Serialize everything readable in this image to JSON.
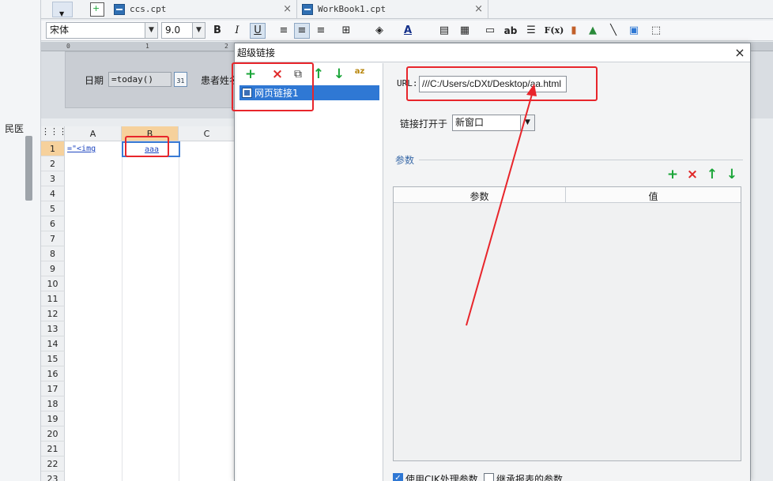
{
  "left_strip": {
    "text_1": "民医"
  },
  "tabs": [
    {
      "label": "ccs.cpt",
      "close": "×"
    },
    {
      "label": "WorkBook1.cpt",
      "close": "×"
    }
  ],
  "toolbar": {
    "font_name": "宋体",
    "font_size": "9.0",
    "bold": "B",
    "italic": "I",
    "underline": "U",
    "text_btn": "ab",
    "formula": "F(x)",
    "font_color": "A"
  },
  "param_pane": {
    "date_label": "日期",
    "date_value": "=today()",
    "cal_day": "31",
    "patient_label": "患者姓名"
  },
  "grid": {
    "columns": [
      "A",
      "B",
      "C"
    ],
    "rows": [
      "1",
      "2",
      "3",
      "4",
      "5",
      "6",
      "7",
      "8",
      "9",
      "10",
      "11",
      "12",
      "13",
      "14",
      "15",
      "16",
      "17",
      "18",
      "19",
      "20",
      "21",
      "22",
      "23"
    ],
    "cell_a1": "=\"<img",
    "cell_b1": "aaa"
  },
  "dialog": {
    "title": "超级链接",
    "close": "×",
    "link_toolbar": {
      "add": "+",
      "remove": "×",
      "copy": "⧉",
      "up": "↑",
      "down": "↓",
      "sort": "az"
    },
    "links": [
      {
        "label": "网页链接1"
      }
    ],
    "url_label": "URL:",
    "url_value": "///C:/Users/cDXt/Desktop/aa.html",
    "open_in_label": "链接打开于",
    "open_in_value": "新窗口",
    "params_legend": "参数",
    "params_toolbar": {
      "add": "+",
      "remove": "×",
      "up": "↑",
      "down": "↓"
    },
    "params_columns": [
      "参数",
      "值"
    ],
    "option_cjk": "使用CJK处理参数",
    "option_inherit": "继承报表的参数"
  },
  "colors": {
    "annotation_red": "#e8252b",
    "selection_blue": "#2f78d4",
    "add_green": "#1aa538",
    "remove_red": "#e02828"
  }
}
